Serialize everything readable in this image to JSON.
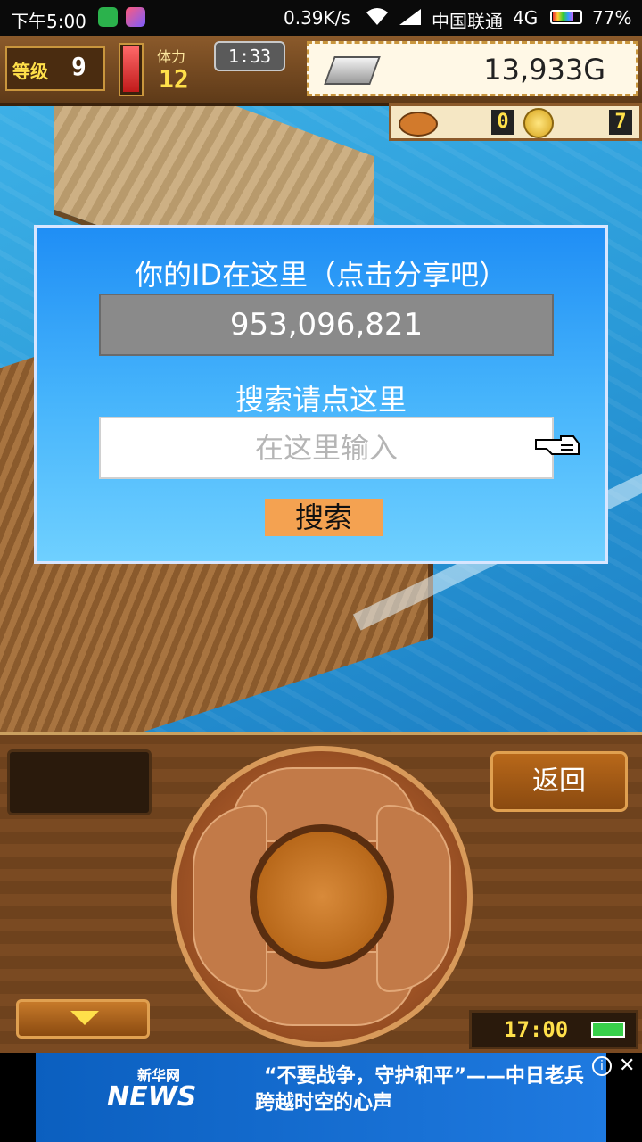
{
  "status_bar": {
    "time": "下午5:00",
    "speed": "0.39K/s",
    "carrier": "中国联通",
    "network": "4G",
    "battery_percent": "77%",
    "battery_level": 0.77
  },
  "hud": {
    "level_label": "等级",
    "level_value": "9",
    "stamina_label": "体力",
    "stamina_value": "12",
    "clock": "1:33",
    "money": "13,933G",
    "count_a": "0",
    "count_b": "7"
  },
  "dialog": {
    "title": "你的ID在这里（点击分享吧）",
    "id_value": "953,096,821",
    "search_prompt": "搜索请点这里",
    "input_placeholder": "在这里输入",
    "search_button": "搜索"
  },
  "panel": {
    "back_button": "返回",
    "clock": "17:00"
  },
  "ad": {
    "logo_top": "新华网",
    "logo_text": "NEWS",
    "line1": "“不要战争，守护和平”——中日老兵",
    "line2": "跨越时空的心声"
  }
}
